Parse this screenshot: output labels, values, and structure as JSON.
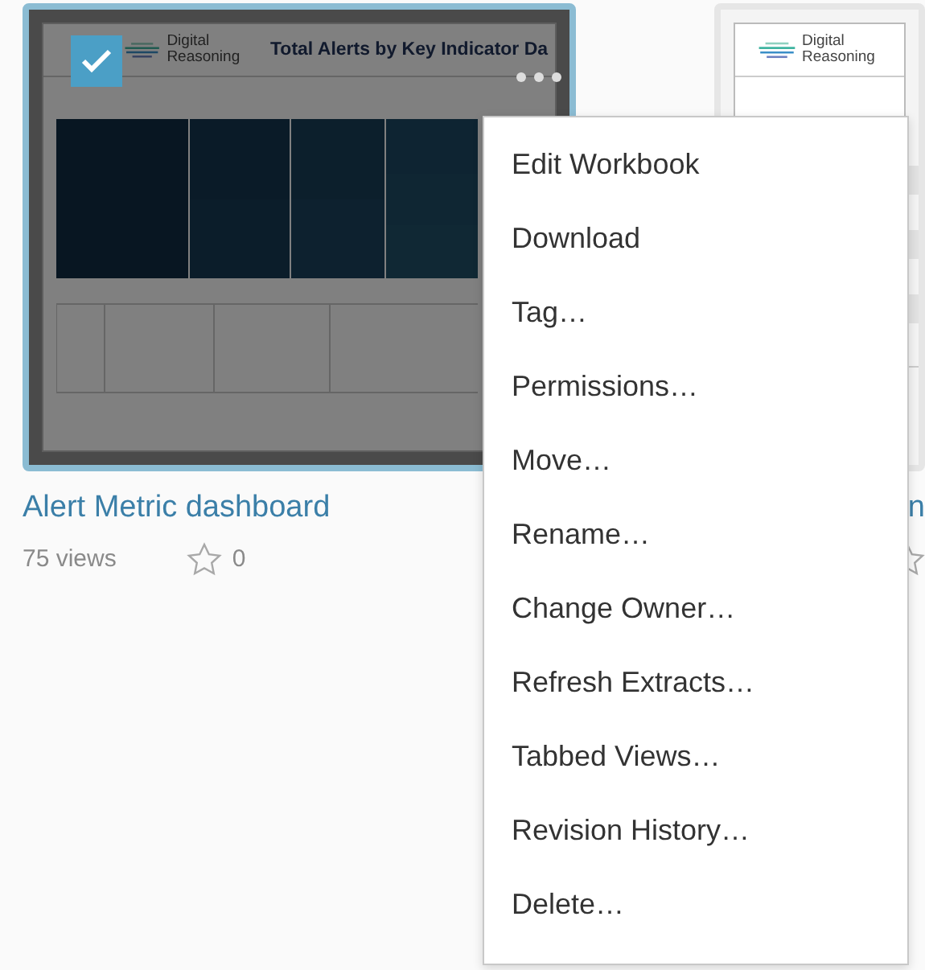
{
  "cards": [
    {
      "title": "Alert Metric dashboard",
      "views": "75 views",
      "favorites": "0",
      "selected": true,
      "thumbnail": {
        "logo": "Digital Reasoning",
        "heading": "Total Alerts by Key Indicator Da"
      }
    },
    {
      "title": "n",
      "selected": false,
      "thumbnail": {
        "logo": "Digital Reasoning"
      }
    }
  ],
  "menu": {
    "items": [
      "Edit Workbook",
      "Download",
      "Tag…",
      "Permissions…",
      "Move…",
      "Rename…",
      "Change Owner…",
      "Refresh Extracts…",
      "Tabbed Views…",
      "Revision History…",
      "Delete…"
    ]
  }
}
